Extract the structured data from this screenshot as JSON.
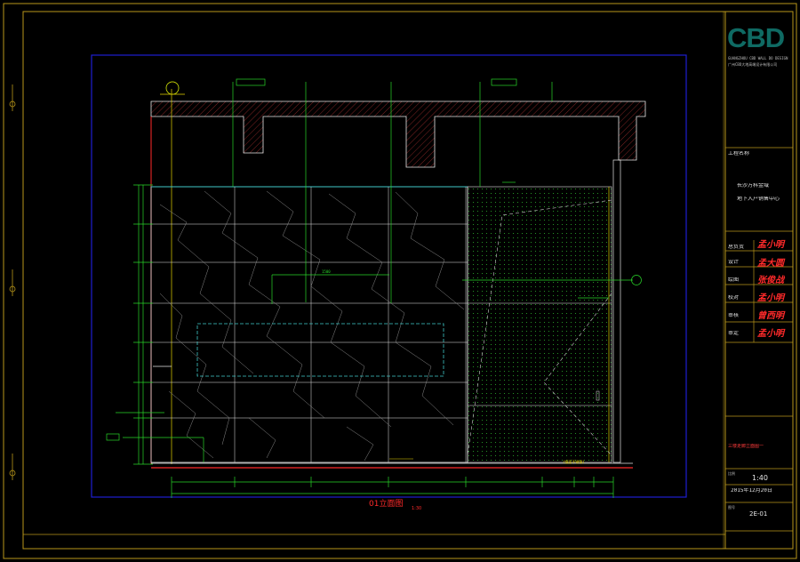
{
  "drawing": {
    "caption": "01立面图",
    "caption_scale": "1:30",
    "mirror_label": "(镜面不锈钢)",
    "wall_dimension_note": "1500"
  },
  "title_block": {
    "logo": "CBD",
    "company_en": "GUANGZHOU CBD WALL DO DESIGN",
    "company_cn": "广州CBD大地高端设计有限公司",
    "project_label": "工程名称",
    "project_name": "长沙万科金域",
    "project_sub": "地下入户销售中心",
    "roles": [
      {
        "role": "总负责",
        "signature": "孟小明"
      },
      {
        "role": "设计",
        "signature": "孟大圆"
      },
      {
        "role": "绘图",
        "signature": "张俊战"
      },
      {
        "role": "校对",
        "signature": "孟小明"
      },
      {
        "role": "审核",
        "signature": "曾西明"
      },
      {
        "role": "审定",
        "signature": "孟小明"
      }
    ],
    "drawing_name": "三楼走廊立面图一",
    "scale_label": "比例",
    "scale": "1:40",
    "date": "2015年12月20日",
    "drawing_no_label": "图号",
    "drawing_no": "2E-01"
  },
  "colors": {
    "frame": "#b8961a",
    "viewport": "#1f1fd0",
    "lines": "#e6e6e6",
    "dim": "#29d629",
    "hatch": "#ff3b3b",
    "cyan": "#3fc9c9",
    "dots": "#2fb52f",
    "yellow": "#e6d400"
  }
}
